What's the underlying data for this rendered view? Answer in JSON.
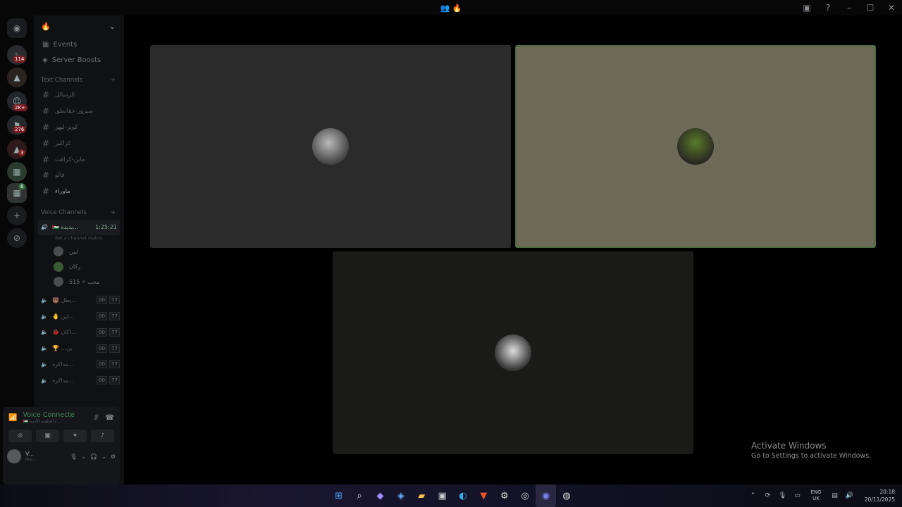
{
  "titlebar": {
    "center": "👥 🔥"
  },
  "rail": {
    "badges": [
      "114",
      "2K+",
      "276",
      "3",
      "6"
    ]
  },
  "server": {
    "name": "🔥"
  },
  "nav": [
    {
      "label": "Events",
      "icon": "calendar-icon"
    },
    {
      "label": "Server Boosts",
      "icon": "boost-icon"
    }
  ],
  "text_category": "Text Channels",
  "text_channels": [
    "الرسائل",
    "سيرور-حقانطق",
    "كويز-ليهز",
    "كراكبر",
    "ماين-كرافت",
    "قالو",
    "ماوراء"
  ],
  "voice_category": "Voice Channels",
  "current_voice": {
    "name": "🇵🇸 بديدة...",
    "timer": "1:25:21",
    "status": "Set a channel status"
  },
  "members": [
    {
      "name": "ليين"
    },
    {
      "name": "ركان"
    },
    {
      "name": "محب ⚡ 515"
    }
  ],
  "voice_channels": [
    {
      "name": "🐻 يطل...",
      "a": "00",
      "b": "77"
    },
    {
      "name": "🤚 لين...",
      "a": "00",
      "b": "77"
    },
    {
      "name": "🐞 اكان...",
      "a": "00",
      "b": "77"
    },
    {
      "name": "🏆 ...ين",
      "a": "00",
      "b": "77"
    },
    {
      "name": "مذاكرة...",
      "a": "00",
      "b": "77"
    },
    {
      "name": "مذاكرة...",
      "a": "00",
      "b": "77"
    }
  ],
  "voicebar": {
    "title": "Voice Connecte",
    "subtitle": "🇵🇸 الجلسة الأدبية / ...",
    "user_name": "V...",
    "user_status": "Inv..."
  },
  "activate": {
    "title": "Activate Windows",
    "subtitle": "Go to Settings to activate Windows."
  },
  "tray": {
    "lang1": "ENG",
    "lang2": "UK",
    "time": "20:18",
    "date": "20/11/2025"
  }
}
